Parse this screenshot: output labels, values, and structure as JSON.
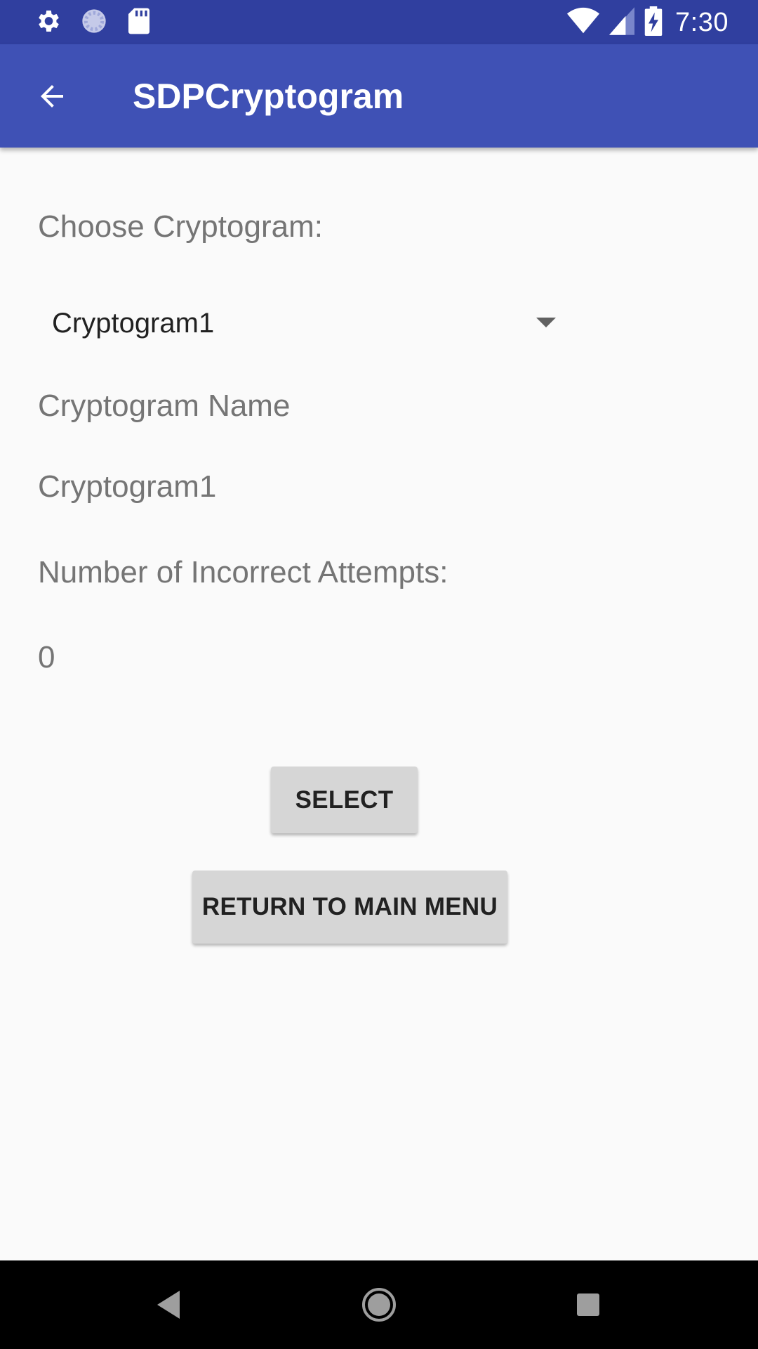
{
  "status_bar": {
    "time": "7:30",
    "icons": [
      "gear-icon",
      "sync-icon",
      "sd-card-icon",
      "wifi-icon",
      "signal-icon",
      "battery-charging-icon"
    ]
  },
  "app_bar": {
    "title": "SDPCryptogram",
    "back_icon": "arrow-back-icon"
  },
  "content": {
    "choose_label": "Choose Cryptogram:",
    "spinner_selected": "Cryptogram1",
    "name_label": "Cryptogram Name",
    "name_value": "Cryptogram1",
    "attempts_label": "Number of Incorrect Attempts:",
    "attempts_value": "0"
  },
  "buttons": {
    "select_label": "SELECT",
    "return_label": "RETURN TO MAIN MENU"
  },
  "nav_bar": {
    "icons": [
      "nav-back-icon",
      "nav-home-icon",
      "nav-recents-icon"
    ]
  },
  "colors": {
    "status_bar": "#303f9f",
    "app_bar": "#3f51b5",
    "background": "#fafafa",
    "button": "#d6d6d6",
    "label_text": "#757575"
  }
}
